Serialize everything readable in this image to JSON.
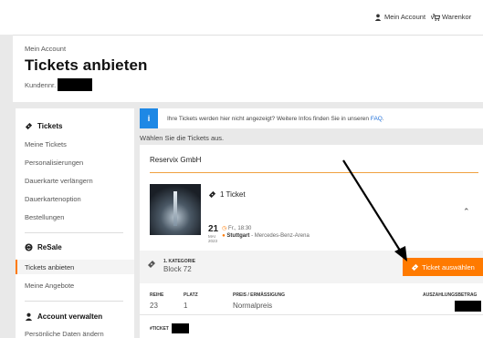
{
  "topbar": {
    "account_label": "Mein Account",
    "cart_label": "Warenkor"
  },
  "header": {
    "breadcrumb": "Mein Account",
    "title": "Tickets anbieten",
    "kundennr_label": "Kundennr."
  },
  "sidebar": {
    "tickets_heading": "Tickets",
    "tickets_items": [
      "Meine Tickets",
      "Personalisierungen",
      "Dauerkarte verlängern",
      "Dauerkartenoption",
      "Bestellungen"
    ],
    "resale_heading": "ReSale",
    "resale_items": [
      "Tickets anbieten",
      "Meine Angebote"
    ],
    "account_heading": "Account verwalten",
    "account_items": [
      "Persönliche Daten ändern"
    ]
  },
  "main": {
    "info_text": "Ihre Tickets werden hier nicht angezeigt? Weitere Infos finden Sie in unseren",
    "info_link": "FAQ",
    "info_end": ".",
    "choose_text": "Wählen Sie die Tickets aus.",
    "organizer": "Reservix GmbH",
    "ticket_count": "1 Ticket",
    "date_day": "21",
    "date_month": "MAI",
    "date_year": "2023",
    "time": "Fr., 18:30",
    "city": "Stuttgart",
    "venue_sep": " - Mercedes-Benz-Arena",
    "category": "1. KATEGORIE",
    "block": "Block 72",
    "select_button": "Ticket auswählen",
    "columns": [
      "REIHE",
      "PLATZ",
      "PREIS / ERMÄSSIGUNG",
      "AUSZAHLUNGSBETRAG"
    ],
    "row": "23",
    "seat": "1",
    "price": "Normalpreis",
    "ticket_label": "#TICKET"
  },
  "colors": {
    "accent": "#ff7a00",
    "info": "#1e88e5"
  }
}
